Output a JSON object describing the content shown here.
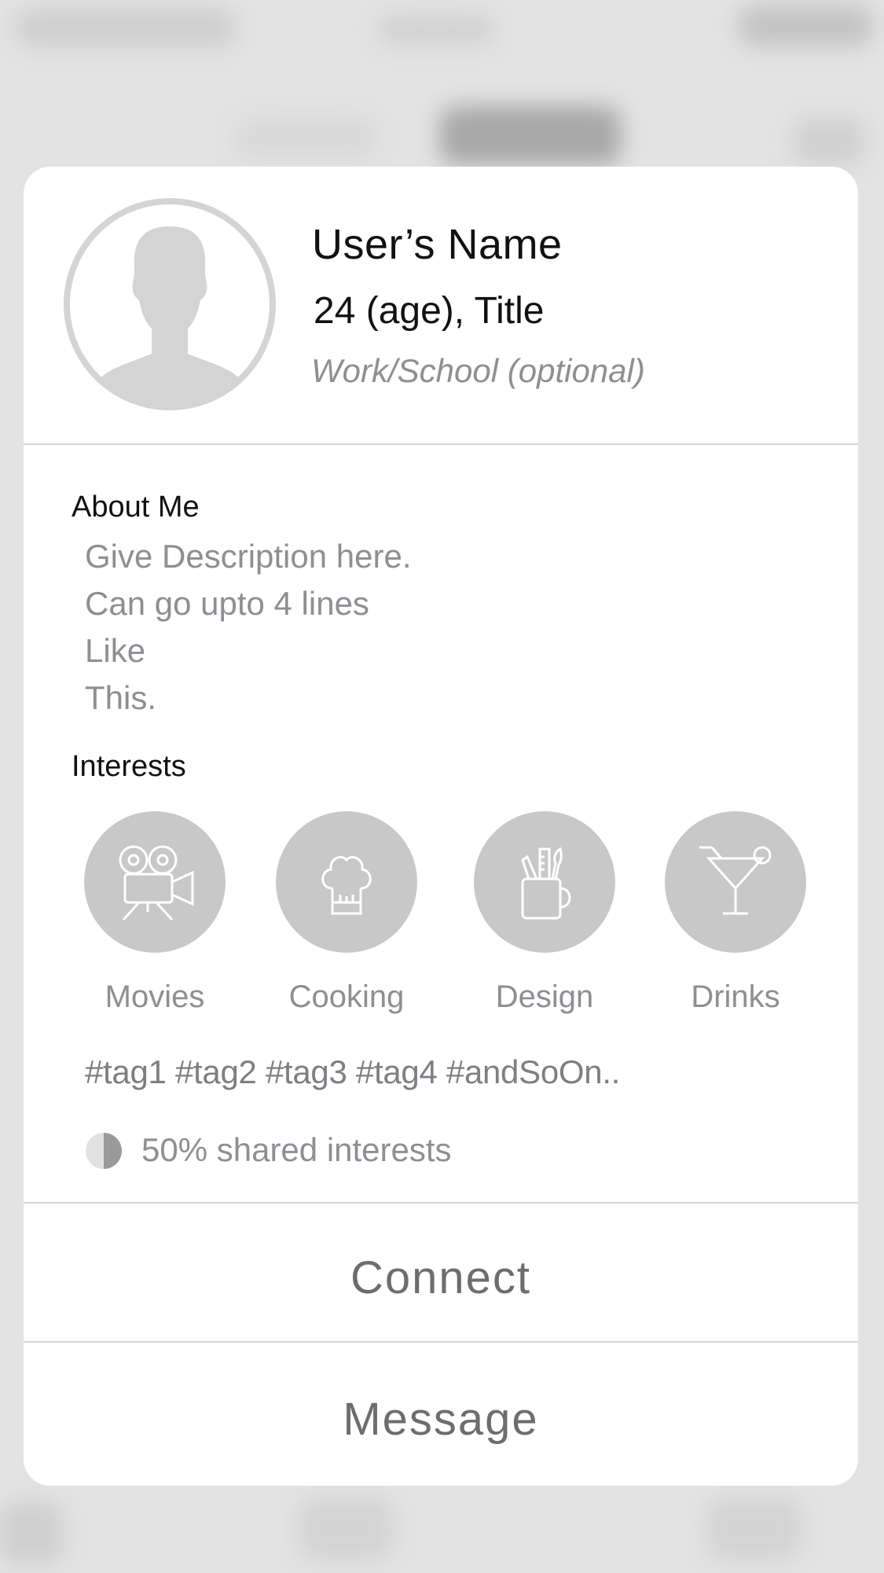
{
  "profile": {
    "name": "User’s Name",
    "subtitle": "24 (age), Title",
    "work": "Work/School (optional)"
  },
  "about": {
    "title": "About Me",
    "lines": [
      "Give Description here.",
      "Can go upto 4 lines",
      "Like",
      "This."
    ]
  },
  "interests": {
    "title": "Interests",
    "items": [
      {
        "label": "Movies",
        "icon": "movie-camera-icon"
      },
      {
        "label": "Cooking",
        "icon": "chef-hat-icon"
      },
      {
        "label": "Design",
        "icon": "design-tools-icon"
      },
      {
        "label": "Drinks",
        "icon": "cocktail-glass-icon"
      }
    ],
    "tags": "#tag1 #tag2 #tag3 #tag4 #andSoOn..",
    "shared_fraction": 0.5,
    "shared_text": "50% shared interests"
  },
  "actions": {
    "connect": "Connect",
    "message": "Message"
  },
  "colors": {
    "card": "#ffffff",
    "icon_circle": "#c8c8c8",
    "secondary_text": "#8e8e93",
    "action_text": "#6d6d6d"
  }
}
